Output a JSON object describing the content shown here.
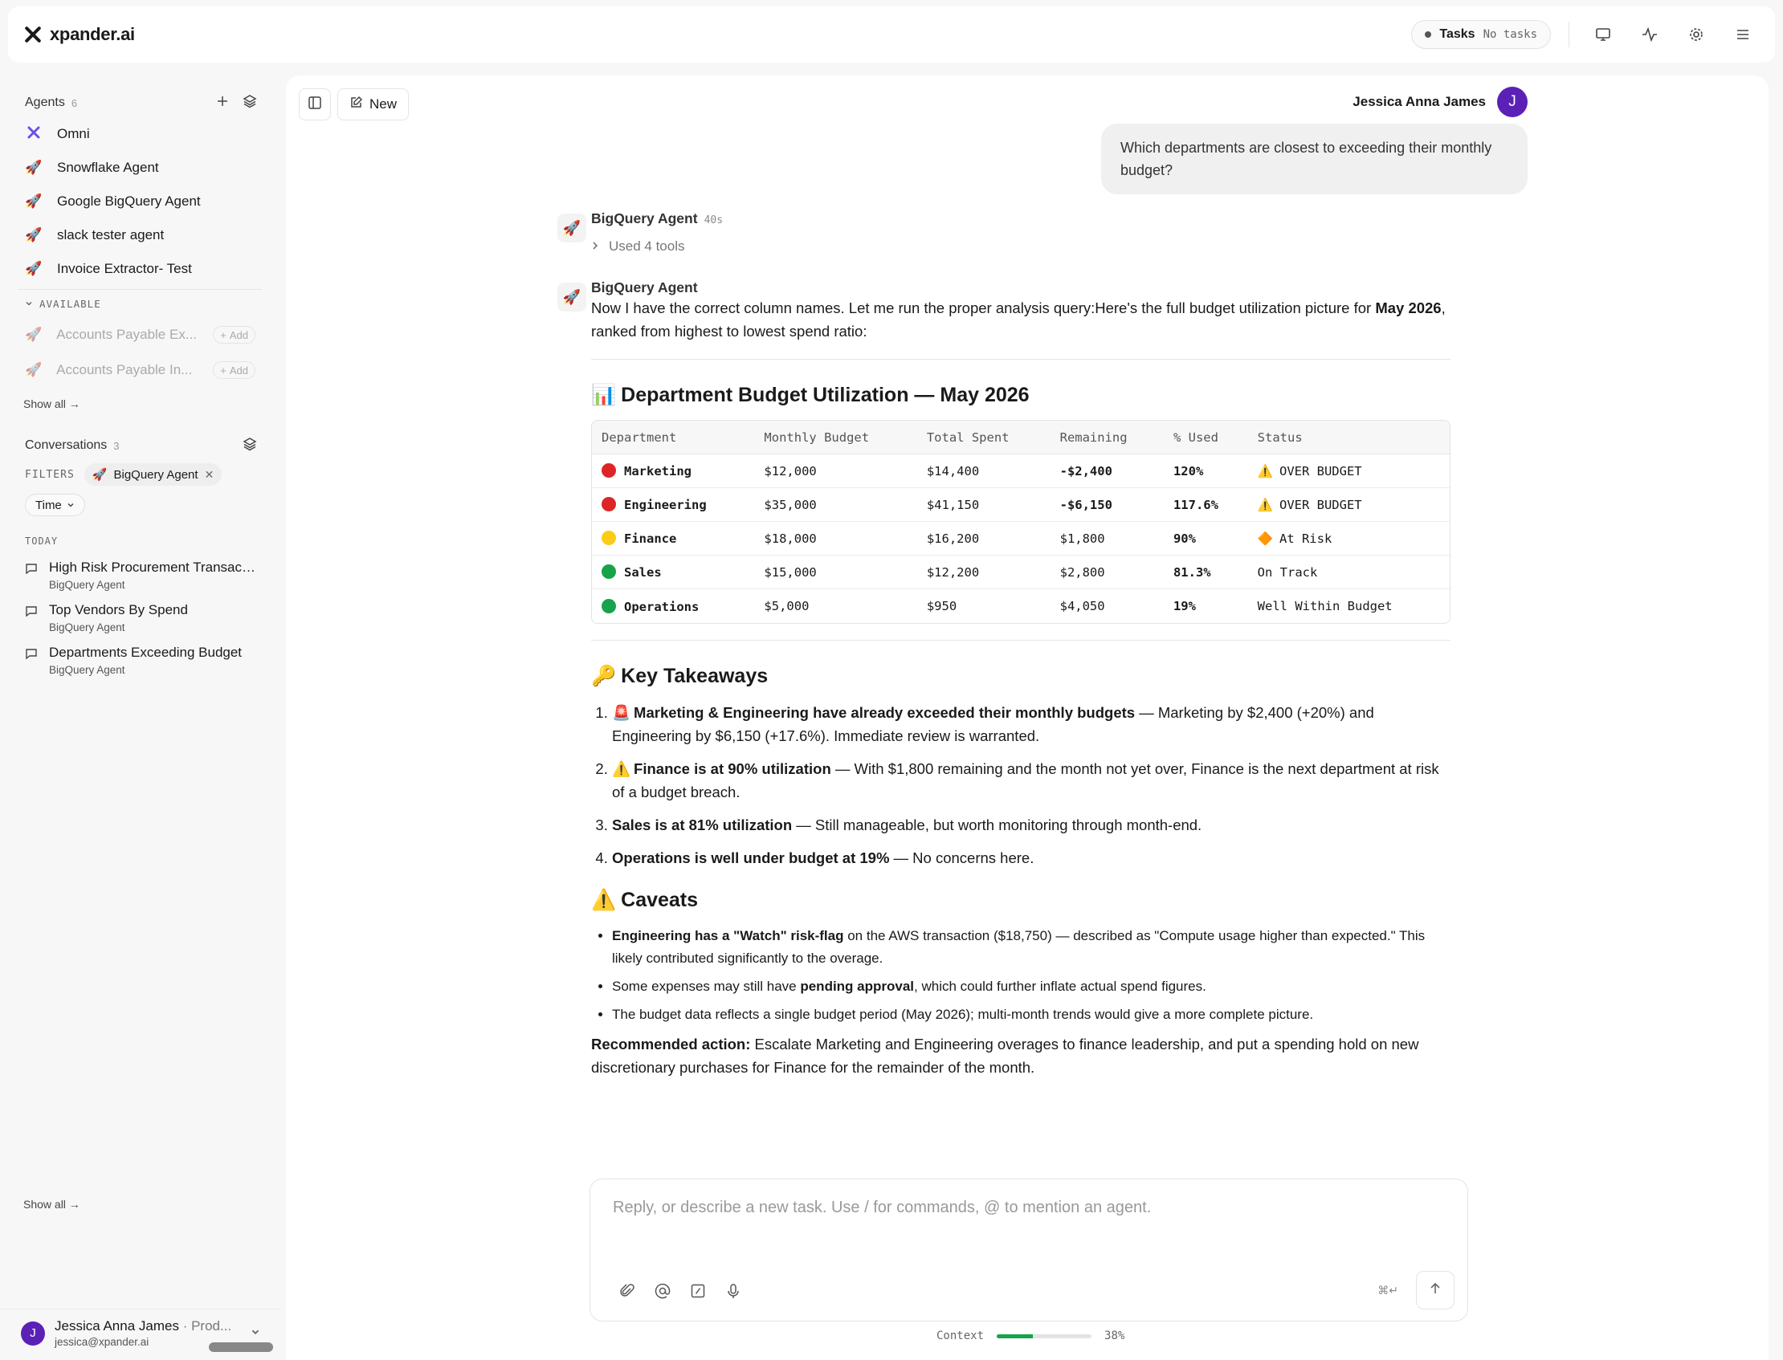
{
  "brand": {
    "name": "xpander.ai"
  },
  "topbar": {
    "tasks_label": "Tasks",
    "tasks_status": "No tasks"
  },
  "sidebar": {
    "agents_label": "Agents",
    "agents_count": "6",
    "agents": [
      {
        "name": "Omni",
        "icon": "omni-icon"
      },
      {
        "name": "Snowflake Agent",
        "icon": "rocket-icon"
      },
      {
        "name": "Google BigQuery Agent",
        "icon": "rocket-icon"
      },
      {
        "name": "slack tester agent",
        "icon": "rocket-icon"
      },
      {
        "name": "Invoice Extractor- Test",
        "icon": "rocket-icon"
      }
    ],
    "available_label": "AVAILABLE",
    "available": [
      {
        "name": "Accounts Payable Ex...",
        "add": "Add"
      },
      {
        "name": "Accounts Payable In...",
        "add": "Add"
      }
    ],
    "show_all": "Show all →",
    "conversations_label": "Conversations",
    "conversations_count": "3",
    "filters_label": "FILTERS",
    "filter_chip": "BigQuery Agent",
    "time_label": "Time",
    "today_label": "TODAY",
    "conversations": [
      {
        "title": "High Risk Procurement Transacti...",
        "agent": "BigQuery Agent"
      },
      {
        "title": "Top Vendors By Spend",
        "agent": "BigQuery Agent"
      },
      {
        "title": "Departments Exceeding Budget",
        "agent": "BigQuery Agent"
      }
    ],
    "show_all_bottom": "Show all →",
    "user": {
      "name": "Jessica Anna James",
      "org": " · Prod...",
      "email": "jessica@xpander.ai",
      "initial": "J"
    }
  },
  "main": {
    "new_label": "New",
    "user_name": "Jessica Anna James",
    "user_initial": "J",
    "user_message": "Which departments are closest to exceeding their monthly budget?",
    "agent_name": "BigQuery Agent",
    "agent_time": "40s",
    "tools_used": "Used 4 tools",
    "intro_a": "Now I have the correct column names. Let me run the proper analysis query:Here's the full budget utilization picture for ",
    "intro_b": "May 2026",
    "intro_c": ", ranked from highest to lowest spend ratio:",
    "table_title": "Department Budget Utilization — May 2026",
    "table_title_emoji": "📊",
    "table_headers": [
      "Department",
      "Monthly Budget",
      "Total Spent",
      "Remaining",
      "% Used",
      "Status"
    ],
    "rows": [
      {
        "dot": "#dc2626",
        "dept": "Marketing",
        "budget": "$12,000",
        "spent": "$14,400",
        "remaining": "-$2,400",
        "pct": "120%",
        "status_icon": "⚠️",
        "status": "OVER BUDGET"
      },
      {
        "dot": "#dc2626",
        "dept": "Engineering",
        "budget": "$35,000",
        "spent": "$41,150",
        "remaining": "-$6,150",
        "pct": "117.6%",
        "status_icon": "⚠️",
        "status": "OVER BUDGET"
      },
      {
        "dot": "#facc15",
        "dept": "Finance",
        "budget": "$18,000",
        "spent": "$16,200",
        "remaining": "$1,800",
        "pct": "90%",
        "status_icon": "🔶",
        "status": "At Risk"
      },
      {
        "dot": "#16a34a",
        "dept": "Sales",
        "budget": "$15,000",
        "spent": "$12,200",
        "remaining": "$2,800",
        "pct": "81.3%",
        "status_icon": "",
        "status": "On Track"
      },
      {
        "dot": "#16a34a",
        "dept": "Operations",
        "budget": "$5,000",
        "spent": "$950",
        "remaining": "$4,050",
        "pct": "19%",
        "status_icon": "",
        "status": "Well Within Budget"
      }
    ],
    "takeaways_title": "Key Takeaways",
    "takeaways_emoji": "🔑",
    "takeaways": [
      {
        "emoji": "🚨",
        "bold": "Marketing & Engineering have already exceeded their monthly budgets",
        "rest": " — Marketing by $2,400 (+20%) and Engineering by $6,150 (+17.6%). Immediate review is warranted."
      },
      {
        "emoji": "⚠️",
        "bold": "Finance is at 90% utilization",
        "rest": " — With $1,800 remaining and the month not yet over, Finance is the next department at risk of a budget breach."
      },
      {
        "emoji": "",
        "bold": "Sales is at 81% utilization",
        "rest": " — Still manageable, but worth monitoring through month-end."
      },
      {
        "emoji": "",
        "bold": "Operations is well under budget at 19%",
        "rest": " — No concerns here."
      }
    ],
    "caveats_title": "Caveats",
    "caveats_emoji": "⚠️",
    "caveats": [
      {
        "a": "",
        "bold": "Engineering has a \"Watch\" risk-flag",
        "c": " on the AWS transaction ($18,750) — described as \"Compute usage higher than expected.\" This likely contributed significantly to the overage."
      },
      {
        "a": "Some expenses may still have ",
        "bold": "pending approval",
        "c": ", which could further inflate actual spend figures."
      },
      {
        "a": "The budget data reflects a single budget period (May 2026); multi-month trends would give a more complete picture.",
        "bold": "",
        "c": ""
      }
    ],
    "recommend_bold": "Recommended action:",
    "recommend_text": " Escalate Marketing and Engineering overages to finance leadership, and put a spending hold on new discretionary purchases for Finance for the remainder of the month.",
    "composer_placeholder": "Reply, or describe a new task. Use / for commands, @ to mention an agent.",
    "shortcut": "⌘↵",
    "context_label": "Context",
    "context_pct": "38%",
    "context_value": 0.38
  }
}
